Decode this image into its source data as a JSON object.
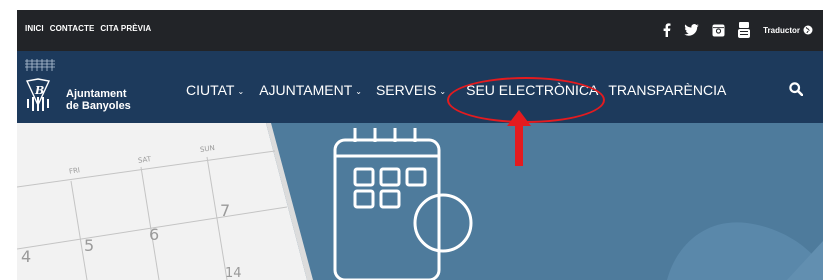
{
  "topbar": {
    "links": [
      "INICI",
      "CONTACTE",
      "CITA PRÈVIA"
    ],
    "social_icons": [
      "facebook-icon",
      "twitter-icon",
      "instagram-icon",
      "youtube-icon"
    ],
    "translator_label": "Traductor"
  },
  "brand": {
    "line1": "Ajuntament",
    "line2": "de Banyoles"
  },
  "nav": {
    "items": [
      {
        "label": "CIUTAT",
        "has_dropdown": true
      },
      {
        "label": "AJUNTAMENT",
        "has_dropdown": true
      },
      {
        "label": "SERVEIS",
        "has_dropdown": true
      },
      {
        "label": "SEU ELECTRÒNICA",
        "has_dropdown": false
      },
      {
        "label": "TRANSPARÈNCIA",
        "has_dropdown": false
      }
    ],
    "search_icon": "search-icon"
  },
  "annotation": {
    "highlighted_item": "SEU ELECTRÒNICA",
    "color": "#e41b1f"
  },
  "hero": {
    "calendar_days": [
      "FRI",
      "SAT",
      "SUN"
    ],
    "calendar_numbers": [
      "4",
      "5",
      "6",
      "7",
      "14"
    ]
  },
  "colors": {
    "topbar_bg": "#222428",
    "nav_bg": "#1d3a5c",
    "hero_bg": "#4e7b9c",
    "annotation": "#e41b1f"
  }
}
